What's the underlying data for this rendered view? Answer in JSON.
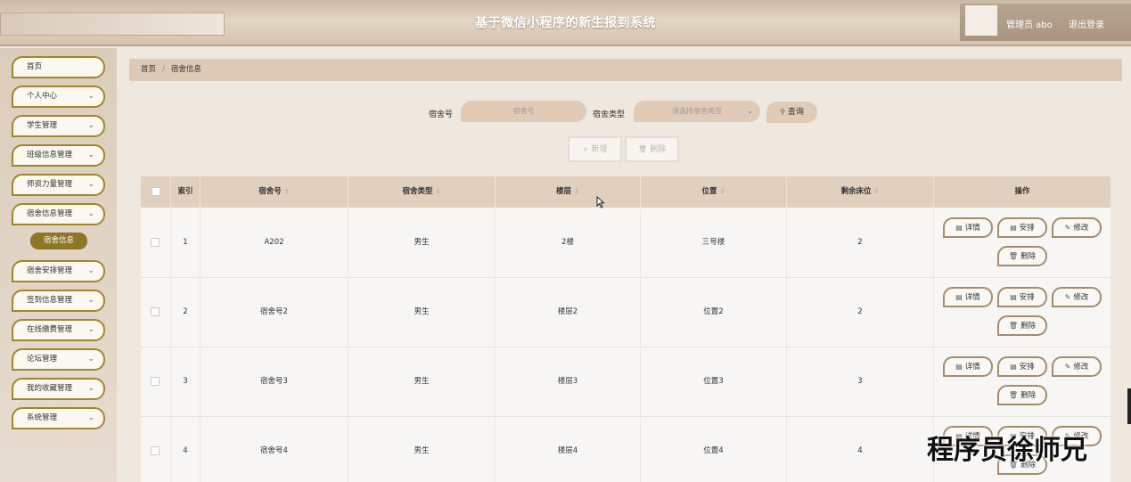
{
  "header": {
    "title": "基于微信小程序的新生报到系统",
    "user": "管理员 abo",
    "logout": "退出登录"
  },
  "sidebar": {
    "items": [
      {
        "label": "首页",
        "has_chevron": false
      },
      {
        "label": "个人中心",
        "has_chevron": true
      },
      {
        "label": "学生管理",
        "has_chevron": true
      },
      {
        "label": "班级信息管理",
        "has_chevron": true
      },
      {
        "label": "师资力量管理",
        "has_chevron": true
      },
      {
        "label": "宿舍信息管理",
        "has_chevron": true
      },
      {
        "label": "宿舍安排管理",
        "has_chevron": true
      },
      {
        "label": "签到信息管理",
        "has_chevron": true
      },
      {
        "label": "在线缴费管理",
        "has_chevron": true
      },
      {
        "label": "论坛管理",
        "has_chevron": true
      },
      {
        "label": "我的收藏管理",
        "has_chevron": true
      },
      {
        "label": "系统管理",
        "has_chevron": true
      }
    ],
    "active_sub": "宿舍信息"
  },
  "breadcrumb": {
    "home": "首页",
    "sep": "/",
    "current": "宿舍信息"
  },
  "search": {
    "dorm_no_label": "宿舍号",
    "dorm_no_placeholder": "宿舍号",
    "dorm_type_label": "宿舍类型",
    "dorm_type_placeholder": "请选择宿舍类型",
    "query_label": "查询"
  },
  "actions": {
    "add_label": "新增",
    "delete_label": "删除"
  },
  "table": {
    "columns": [
      "索引",
      "宿舍号",
      "宿舍类型",
      "楼层",
      "位置",
      "剩余床位",
      "操作"
    ],
    "rows": [
      {
        "index": "1",
        "dorm_no": "A202",
        "type": "男生",
        "floor": "2楼",
        "location": "三号楼",
        "beds": "2"
      },
      {
        "index": "2",
        "dorm_no": "宿舍号2",
        "type": "男生",
        "floor": "楼层2",
        "location": "位置2",
        "beds": "2"
      },
      {
        "index": "3",
        "dorm_no": "宿舍号3",
        "type": "男生",
        "floor": "楼层3",
        "location": "位置3",
        "beds": "3"
      },
      {
        "index": "4",
        "dorm_no": "宿舍号4",
        "type": "男生",
        "floor": "楼层4",
        "location": "位置4",
        "beds": "4"
      }
    ],
    "ops": {
      "detail": "详情",
      "arrange": "安排",
      "edit": "修改",
      "delete": "删除"
    }
  },
  "watermark": "程序员徐师兄",
  "colors": {
    "accent": "#a2862a",
    "sub_active": "#8d7626",
    "header_bg": "#e2d0be"
  }
}
